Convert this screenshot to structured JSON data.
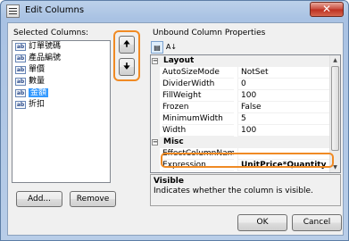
{
  "window": {
    "title": "Edit Columns",
    "close_glyph": "✕"
  },
  "left": {
    "label": "Selected Columns:",
    "columns": [
      {
        "label": "訂單號碼",
        "selected": false
      },
      {
        "label": "產品編號",
        "selected": false
      },
      {
        "label": "單價",
        "selected": false
      },
      {
        "label": "數量",
        "selected": false
      },
      {
        "label": "金額",
        "selected": true
      },
      {
        "label": "折扣",
        "selected": false
      }
    ],
    "column_icon_text": "ab",
    "move_up_glyph": "🠉",
    "move_down_glyph": "🠋",
    "add_button": "Add...",
    "remove_button": "Remove"
  },
  "right": {
    "label": "Unbound Column Properties",
    "toolbar": {
      "categorized_glyph": "▤",
      "alphabetical_glyph": "A↓"
    },
    "categories": [
      {
        "name": "Layout",
        "props": [
          {
            "name": "AutoSizeMode",
            "value": "NotSet"
          },
          {
            "name": "DividerWidth",
            "value": "0"
          },
          {
            "name": "FillWeight",
            "value": "100"
          },
          {
            "name": "Frozen",
            "value": "False"
          },
          {
            "name": "MinimumWidth",
            "value": "5"
          },
          {
            "name": "Width",
            "value": "100"
          }
        ]
      },
      {
        "name": "Misc",
        "props": [
          {
            "name": "EffectColumnNames",
            "value": ""
          },
          {
            "name": "Expression",
            "value": "UnitPrice*Quantity"
          }
        ]
      }
    ],
    "description": {
      "title": "Visible",
      "text": "Indicates whether the column is visible."
    }
  },
  "footer": {
    "ok_button": "OK",
    "cancel_button": "Cancel"
  },
  "colors": {
    "highlight": "#f08a24",
    "selection": "#3399ff"
  }
}
